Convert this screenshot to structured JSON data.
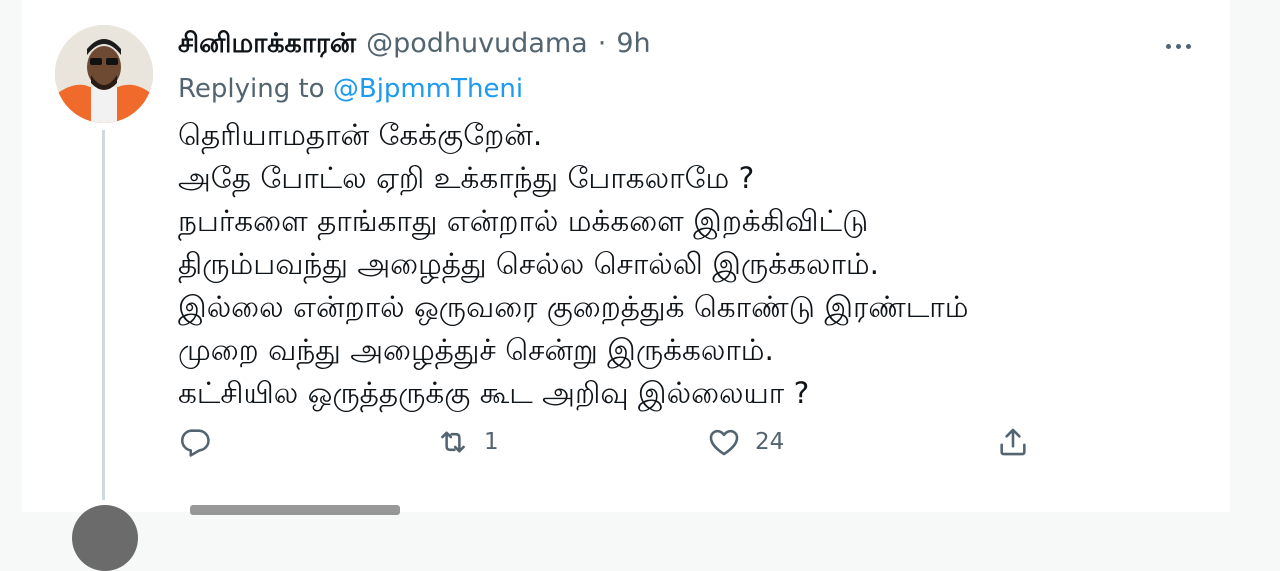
{
  "tweet": {
    "display_name": "சினிமாக்காரன்",
    "handle": "@podhuvudama",
    "separator": "·",
    "time": "9h",
    "replying_prefix": "Replying to",
    "replying_to": "@BjpmmTheni",
    "lines": [
      "தெரியாமதான் கேக்குறேன்.",
      "அதே போட்ல ஏறி உக்காந்து போகலாமே ?",
      "நபர்களை தாங்காது என்றால் மக்களை இறக்கிவிட்டு",
      "திரும்பவந்து அழைத்து செல்ல சொல்லி இருக்கலாம்.",
      "இல்லை என்றால் ஒருவரை குறைத்துக் கொண்டு இரண்டாம்",
      "முறை வந்து அழைத்துச் சென்று இருக்கலாம்.",
      "கட்சியில ஒருத்தருக்கு கூட அறிவு இல்லையா ?"
    ],
    "actions": {
      "reply_icon": "reply-icon",
      "retweet_icon": "retweet-icon",
      "retweet_count": "1",
      "like_icon": "heart-icon",
      "like_count": "24",
      "share_icon": "share-icon"
    },
    "colors": {
      "link": "#1d9bf0",
      "secondary_text": "#536471",
      "text": "#0f1419"
    }
  }
}
